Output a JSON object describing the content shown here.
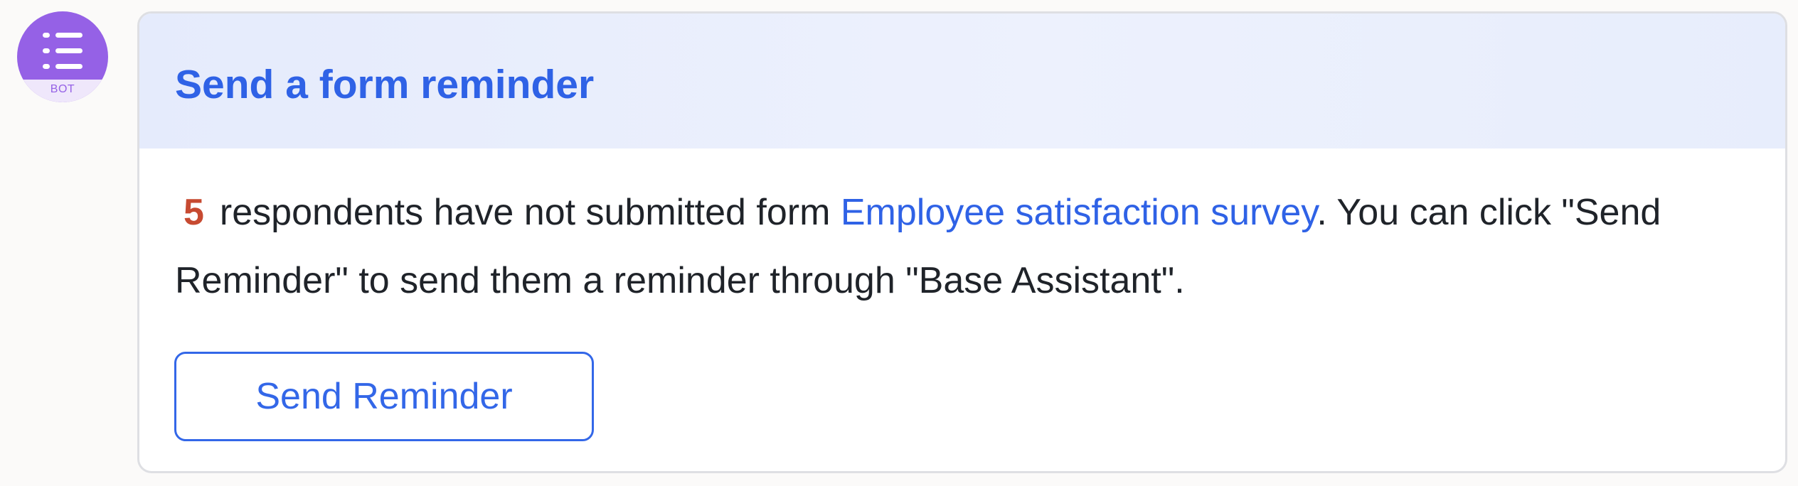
{
  "bot": {
    "avatar_label": "BOT",
    "avatar_color": "#9561e6",
    "avatar_icon": "list-icon"
  },
  "card": {
    "title": "Send a form reminder",
    "message": {
      "count": "5",
      "text_before_link": "respondents have not submitted form ",
      "form_name": "Employee satisfaction survey",
      "text_after_link": ". You can click \"Send Reminder\" to send them a reminder through \"Base Assistant\"."
    },
    "button_label": "Send Reminder"
  },
  "colors": {
    "accent": "#2f62e6",
    "count": "#c74a31",
    "header_background": "#e8eefc",
    "text": "#1f2329"
  }
}
